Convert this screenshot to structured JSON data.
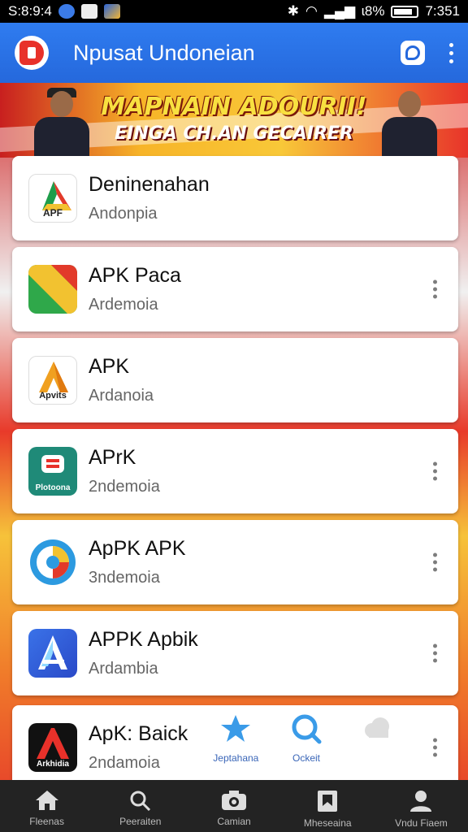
{
  "statusbar": {
    "time_left": "S:8:9:4",
    "battery_pct": "ɩ8%",
    "clock": "7:351"
  },
  "header": {
    "title": "Npusat Undoneian"
  },
  "banner": {
    "title": "MAPNAIN ADOURII!",
    "subtitle": "EINGA CH.AN GECAIRER"
  },
  "apps": [
    {
      "name": "Deninenahan",
      "subtitle": "Andonpia",
      "icon_label": "APF",
      "icon": "google-drive-like-icon",
      "has_menu": false
    },
    {
      "name": "APK Paca",
      "subtitle": "Ardemoia",
      "icon_label": "",
      "icon": "striped-icon",
      "has_menu": true
    },
    {
      "name": "APK",
      "subtitle": "Ardanoia",
      "icon_label": "Apvits",
      "icon": "orange-a-icon",
      "has_menu": false
    },
    {
      "name": "APrK",
      "subtitle": "2ndemoia",
      "icon_label": "Plotoona",
      "icon": "teal-b-icon",
      "has_menu": true
    },
    {
      "name": "ApPK APK",
      "subtitle": "3ndemoia",
      "icon_label": "",
      "icon": "circle-swirl-icon",
      "has_menu": true
    },
    {
      "name": "APPK Apbik",
      "subtitle": "Ardambia",
      "icon_label": "",
      "icon": "blue-a-icon",
      "has_menu": true
    },
    {
      "name": "ApK: Baick",
      "subtitle": "2ndamoia",
      "icon_label": "Arkhidia",
      "icon": "red-a-icon",
      "has_menu": true
    }
  ],
  "float_actions": [
    {
      "label": "Jeptahana",
      "icon": "star-icon"
    },
    {
      "label": "Ockeit",
      "icon": "search-icon"
    },
    {
      "label": "",
      "icon": "cloud-icon"
    }
  ],
  "bottom_nav": [
    {
      "label": "Fleenas",
      "icon": "home-icon"
    },
    {
      "label": "Peeraiten",
      "icon": "search-icon"
    },
    {
      "label": "Camian",
      "icon": "camera-icon"
    },
    {
      "label": "Mheseaina",
      "icon": "bookmark-icon"
    },
    {
      "label": "Vndu Fiaem",
      "icon": "person-icon"
    }
  ],
  "colors": {
    "appbar": "#2568dc",
    "accent_red": "#e8312a",
    "nav_bg": "#232323"
  }
}
